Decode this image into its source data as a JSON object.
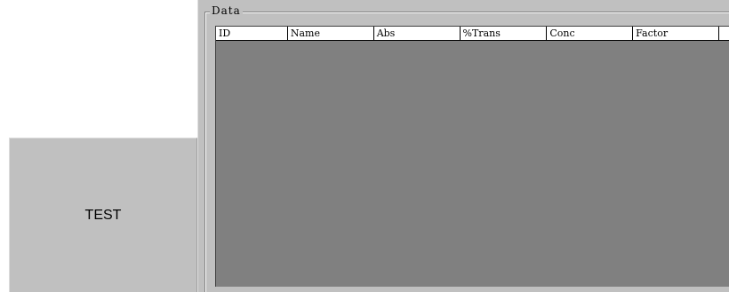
{
  "test_button": {
    "label": "TEST"
  },
  "groupbox": {
    "title": "Data"
  },
  "grid": {
    "columns": [
      "ID",
      "Name",
      "Abs",
      "%Trans",
      "Conc",
      "Factor"
    ]
  }
}
